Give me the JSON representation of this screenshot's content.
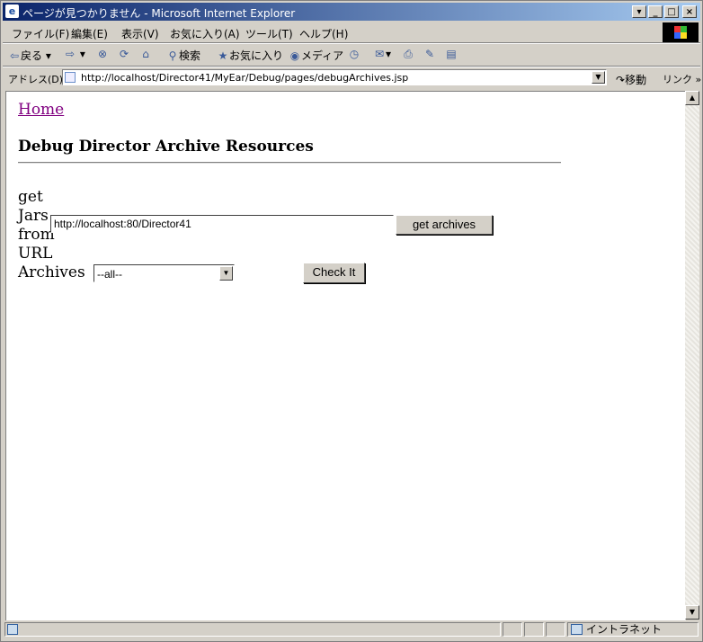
{
  "window": {
    "title": "ページが見つかりません - Microsoft Internet Explorer",
    "icon": "ie-page-icon"
  },
  "menubar": {
    "items": [
      "ファイル(F)",
      "編集(E)",
      "表示(V)",
      "お気に入り(A)",
      "ツール(T)",
      "ヘルプ(H)"
    ]
  },
  "toolbar": {
    "back": "戻る",
    "search": "検索",
    "favorites": "お気に入り",
    "media": "メディア"
  },
  "address": {
    "label": "アドレス(D)",
    "url": "http://localhost/Director41/MyEar/Debug/pages/debugArchives.jsp",
    "go_label": "移動",
    "links_label": "リンク"
  },
  "page": {
    "home_link": "Home",
    "heading": "Debug Director Archive Resources",
    "jars_label": "get Jars from URL",
    "url_value": "http://localhost:80/Director41",
    "get_archives_button": "get archives",
    "archives_label": "Archives",
    "archives_selected": "--all--",
    "check_button": "Check It"
  },
  "status": {
    "zone": "イントラネット"
  }
}
